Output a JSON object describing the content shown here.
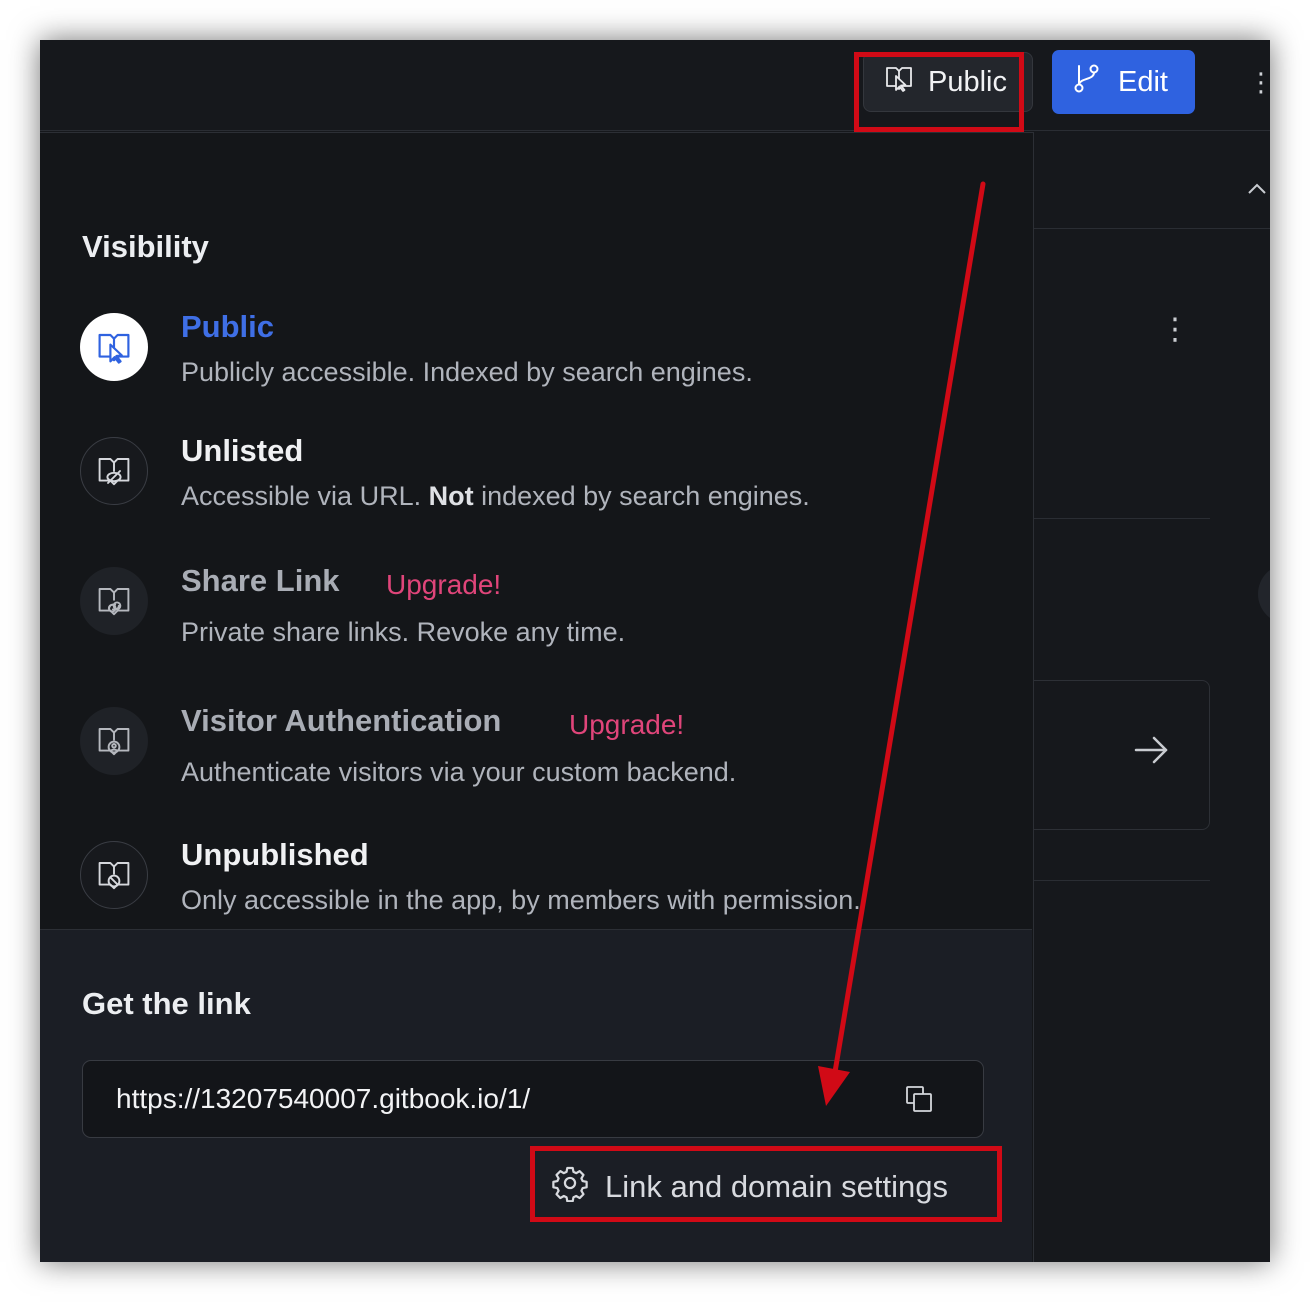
{
  "header": {
    "public_button_label": "Public",
    "edit_button_label": "Edit"
  },
  "visibility": {
    "title": "Visibility",
    "options": [
      {
        "id": "public",
        "title": "Public",
        "description": "Publicly accessible. Indexed by search engines.",
        "badge": "",
        "state": "selected",
        "icon": "book-cursor-icon"
      },
      {
        "id": "unlisted",
        "title": "Unlisted",
        "description_pre": "Accessible via URL. ",
        "description_bold": "Not",
        "description_post": " indexed by search engines.",
        "badge": "",
        "state": "normal",
        "icon": "book-eye-off-icon"
      },
      {
        "id": "share-link",
        "title": "Share Link",
        "description": "Private share links. Revoke any time.",
        "badge": "Upgrade!",
        "state": "disabled",
        "icon": "book-link-icon"
      },
      {
        "id": "visitor-authentication",
        "title": "Visitor Authentication",
        "description": "Authenticate visitors via your custom backend.",
        "badge": "Upgrade!",
        "state": "disabled",
        "icon": "book-user-icon"
      },
      {
        "id": "unpublished",
        "title": "Unpublished",
        "description": "Only accessible in the app, by members with permission.",
        "badge": "",
        "state": "normal",
        "icon": "book-block-icon"
      }
    ]
  },
  "link": {
    "title": "Get the link",
    "url": "https://13207540007.gitbook.io/1/",
    "settings_label": "Link and domain settings"
  },
  "colors": {
    "accent": "#2f62e0",
    "selected_title": "#3f6fe6",
    "upgrade_badge": "#e0457a",
    "annotation": "#d10a16",
    "background": "#16181c"
  }
}
